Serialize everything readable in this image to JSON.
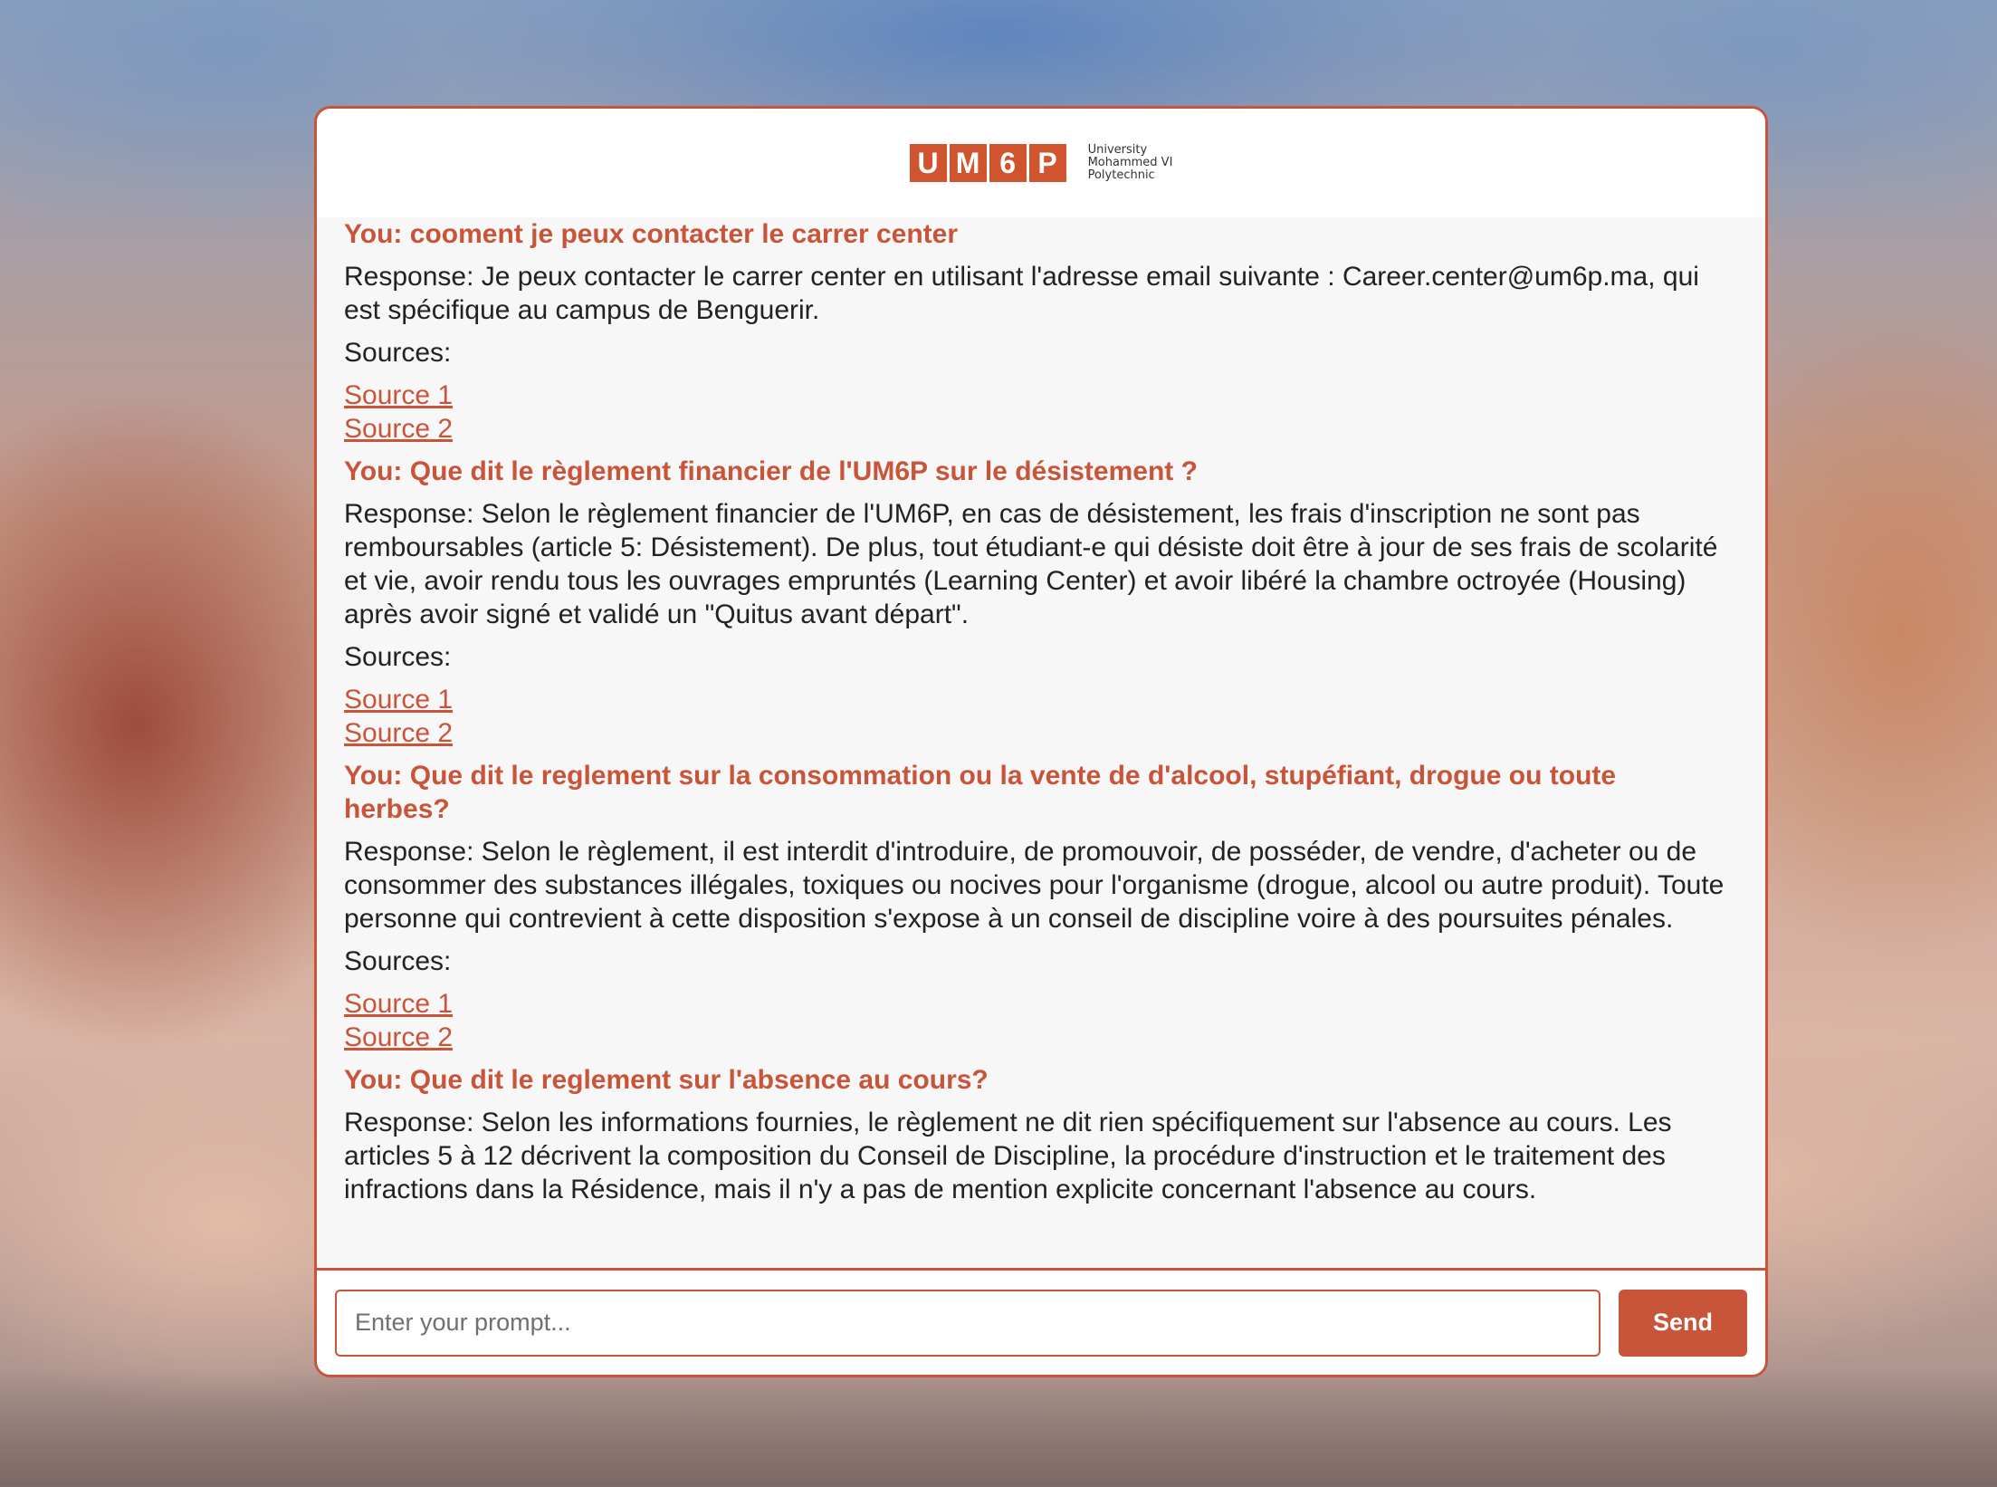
{
  "logo": {
    "letters": [
      "U",
      "M",
      "6",
      "P"
    ],
    "tagline": [
      "University",
      "Mohammed VI",
      "Polytechnic"
    ]
  },
  "messages": [
    {
      "question": "You: cooment je peux contacter le carrer center",
      "response": "Response: Je peux contacter le carrer center en utilisant l'adresse email suivante : Career.center@um6p.ma, qui est spécifique au campus de Benguerir.",
      "sources_label": "Sources:",
      "sources": [
        "Source 1",
        "Source 2"
      ]
    },
    {
      "question": "You: Que dit le règlement financier de l'UM6P sur le désistement ?",
      "response": "Response: Selon le règlement financier de l'UM6P, en cas de désistement, les frais d'inscription ne sont pas remboursables (article 5: Désistement). De plus, tout étudiant-e qui désiste doit être à jour de ses frais de scolarité et vie, avoir rendu tous les ouvrages empruntés (Learning Center) et avoir libéré la chambre octroyée (Housing) après avoir signé et validé un \"Quitus avant départ\".",
      "sources_label": "Sources:",
      "sources": [
        "Source 1",
        "Source 2"
      ]
    },
    {
      "question": "You: Que dit le reglement sur la consommation ou la vente de d'alcool, stupéfiant, drogue ou toute herbes?",
      "response": "Response: Selon le règlement, il est interdit d'introduire, de promouvoir, de posséder, de vendre, d'acheter ou de consommer des substances illégales, toxiques ou nocives pour l'organisme (drogue, alcool ou autre produit). Toute personne qui contrevient à cette disposition s'expose à un conseil de discipline voire à des poursuites pénales.",
      "sources_label": "Sources:",
      "sources": [
        "Source 1",
        "Source 2"
      ]
    },
    {
      "question": "You: Que dit le reglement sur l'absence au cours?",
      "response": "Response: Selon les informations fournies, le règlement ne dit rien spécifiquement sur l'absence au cours. Les articles 5 à 12 décrivent la composition du Conseil de Discipline, la procédure d'instruction et le traitement des infractions dans la Résidence, mais il n'y a pas de mention explicite concernant l'absence au cours."
    }
  ],
  "input": {
    "placeholder": "Enter your prompt...",
    "value": ""
  },
  "send_label": "Send",
  "colors": {
    "accent": "#c8553a",
    "panel": "#f7f7f7",
    "text": "#222222"
  }
}
